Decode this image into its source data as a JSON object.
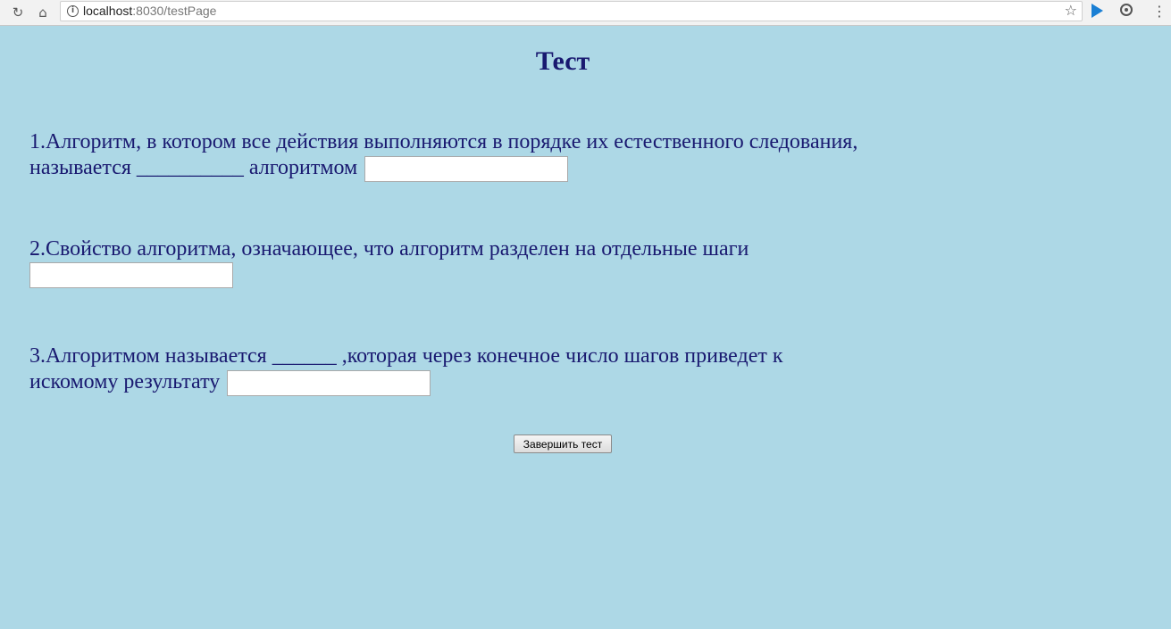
{
  "browser": {
    "url_host": "localhost",
    "url_rest": ":8030/testPage",
    "icons": {
      "back": "reload-icon",
      "home": "home-icon",
      "info": "info-icon",
      "bookmark": "star-icon",
      "extension1": "play-icon",
      "extension2": "sync-icon",
      "menu": "menu-icon"
    },
    "info_glyph": "i",
    "star_glyph": "☆",
    "menu_glyph": "⋮",
    "reload_glyph": "↻",
    "home_glyph": "⌂"
  },
  "page": {
    "title": "Тест",
    "colors": {
      "background": "#add8e6",
      "text": "#191970"
    },
    "questions": [
      {
        "text_line1": "1.Алгоритм, в котором все действия выполняются в порядке их естественного следования,",
        "text_line2": "называется __________ алгоритмом",
        "answer_value": ""
      },
      {
        "text_line1": "2.Свойство алгоритма, означающее, что алгоритм разделен на отдельные шаги",
        "answer_value": ""
      },
      {
        "text_line1": "3.Алгоритмом называется ______ ,которая через конечное число шагов приведет к",
        "text_line2": "искомому результату",
        "answer_value": ""
      }
    ],
    "submit_label": "Завершить тест"
  }
}
